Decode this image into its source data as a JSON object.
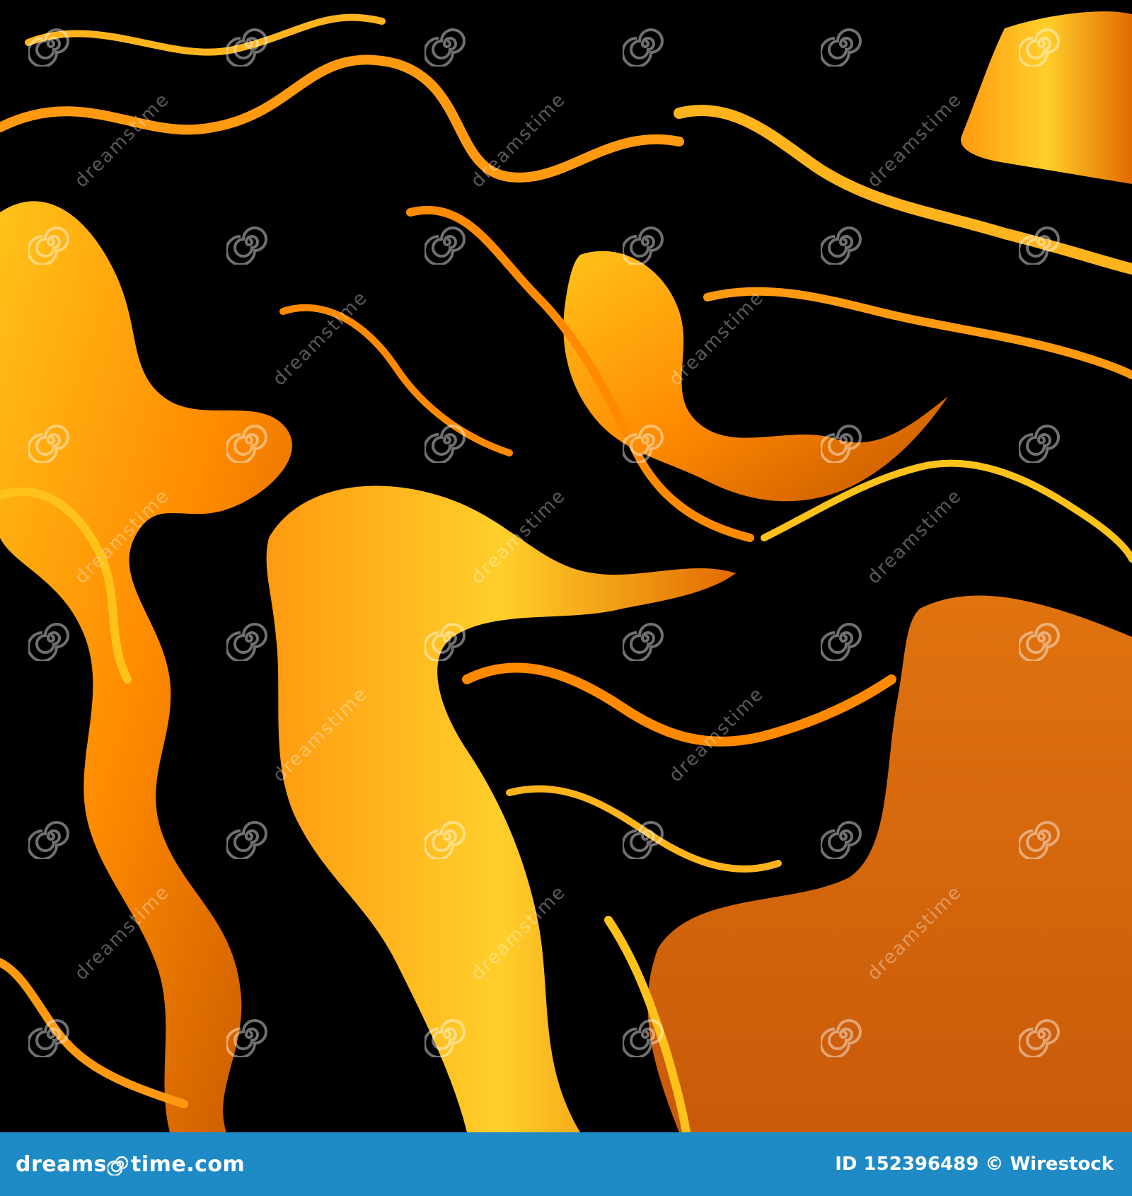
{
  "image": {
    "description_colors": {
      "background": "#000000",
      "orange_dark": "#c25400",
      "orange": "#ff8a00",
      "gold": "#ffc21a",
      "bar": "#1f8bc6"
    }
  },
  "watermark": {
    "word": "dreamstime",
    "icon": "spiral-icon"
  },
  "footer": {
    "brand_prefix": "dreams",
    "brand_suffix": "time.com",
    "id_text": "ID 152396489",
    "credit_text": "© Wirestock"
  }
}
